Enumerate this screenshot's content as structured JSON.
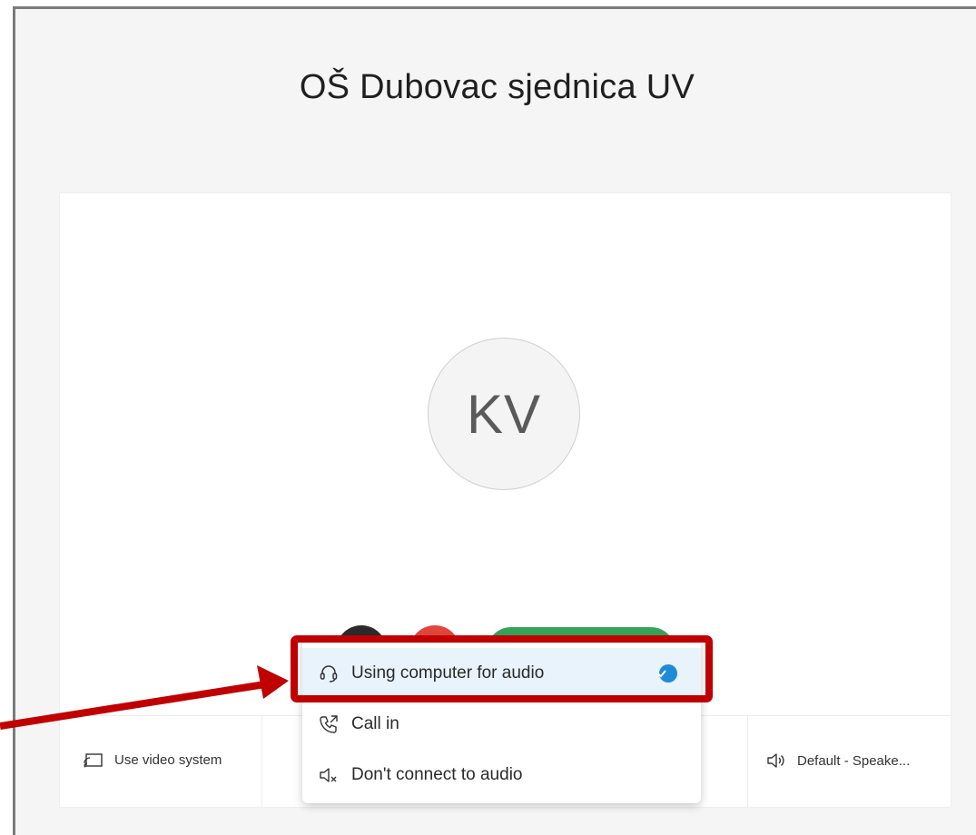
{
  "meeting": {
    "title": "OŠ Dubovac sjednica UV",
    "avatar_initials": "KV"
  },
  "bottom_bar": {
    "video_system_label": "Use video system",
    "speaker_label": "Default - Speake..."
  },
  "audio_menu": {
    "items": [
      {
        "label": "Using computer for audio",
        "icon": "headset-icon",
        "selected": true
      },
      {
        "label": "Call in",
        "icon": "phone-call-icon",
        "selected": false
      },
      {
        "label": "Don't connect to audio",
        "icon": "speaker-mute-icon",
        "selected": false
      }
    ]
  },
  "colors": {
    "highlight": "#c00000",
    "join_button": "#36a35a",
    "leave_button": "#e0463b",
    "check": "#1f8ad8",
    "selected_bg": "#e8f3fc"
  }
}
